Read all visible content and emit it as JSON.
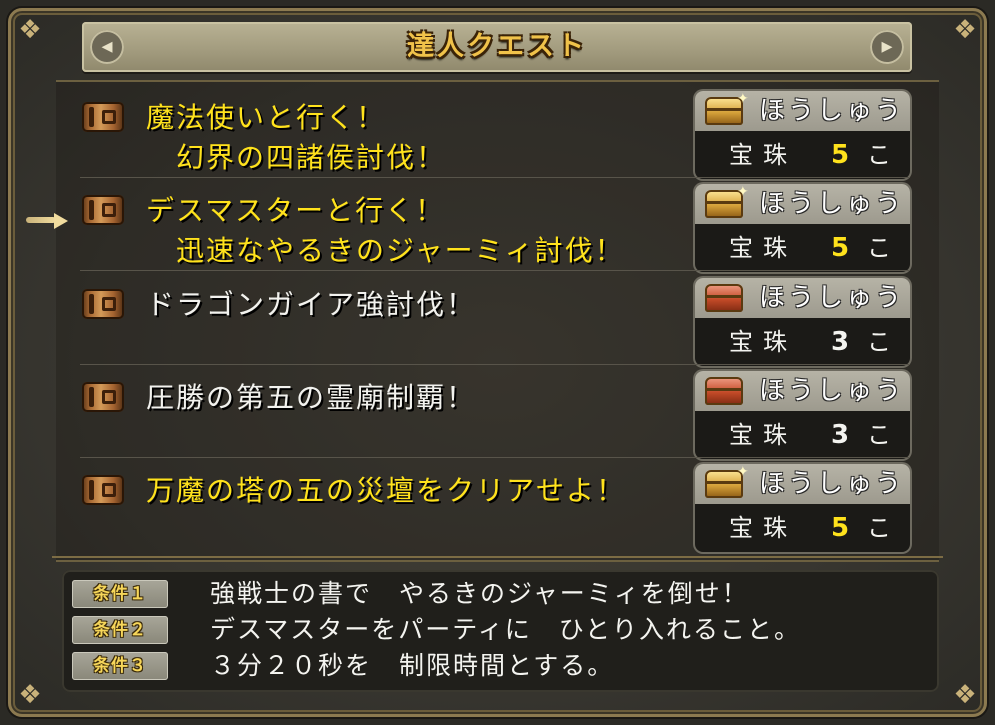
{
  "title": "達人クエスト",
  "title_arrows": {
    "left": "◂",
    "right": "▸"
  },
  "colors": {
    "highlight_text": "#ffe21c",
    "normal_text": "#f2f2ee",
    "title_text": "#f0c24a",
    "frame_gold": "#c9b27a"
  },
  "quests": [
    {
      "line1": "魔法使いと行く！",
      "line2": "幻界の四諸侯討伐！",
      "color": "yellow",
      "reward_label": "ほうしゅう",
      "reward_item": "宝珠",
      "reward_count": "5",
      "reward_unit": "こ",
      "chest": "gold-chest-icon",
      "count_color": "yellow"
    },
    {
      "line1": "デスマスターと行く！",
      "line2": "迅速なやるきのジャーミィ討伐！",
      "color": "yellow",
      "reward_label": "ほうしゅう",
      "reward_item": "宝珠",
      "reward_count": "5",
      "reward_unit": "こ",
      "chest": "gold-chest-icon",
      "count_color": "yellow"
    },
    {
      "line1": "ドラゴンガイア強討伐！",
      "line2": "",
      "color": "white",
      "reward_label": "ほうしゅう",
      "reward_item": "宝珠",
      "reward_count": "3",
      "reward_unit": "こ",
      "chest": "red-chest-icon",
      "count_color": "white"
    },
    {
      "line1": "圧勝の第五の霊廟制覇！",
      "line2": "",
      "color": "white",
      "reward_label": "ほうしゅう",
      "reward_item": "宝珠",
      "reward_count": "3",
      "reward_unit": "こ",
      "chest": "red-chest-icon",
      "count_color": "white"
    },
    {
      "line1": "万魔の塔の五の災壇をクリアせよ！",
      "line2": "",
      "color": "yellow",
      "reward_label": "ほうしゅう",
      "reward_item": "宝珠",
      "reward_count": "5",
      "reward_unit": "こ",
      "chest": "gold-chest-icon",
      "count_color": "yellow"
    }
  ],
  "selected_index": 1,
  "conditions": [
    {
      "label": "条件１",
      "text": "強戦士の書で　やるきのジャーミィを倒せ！"
    },
    {
      "label": "条件２",
      "text": "デスマスターをパーティに　ひとり入れること。"
    },
    {
      "label": "条件３",
      "text": "３分２０秒を　制限時間とする。"
    }
  ]
}
